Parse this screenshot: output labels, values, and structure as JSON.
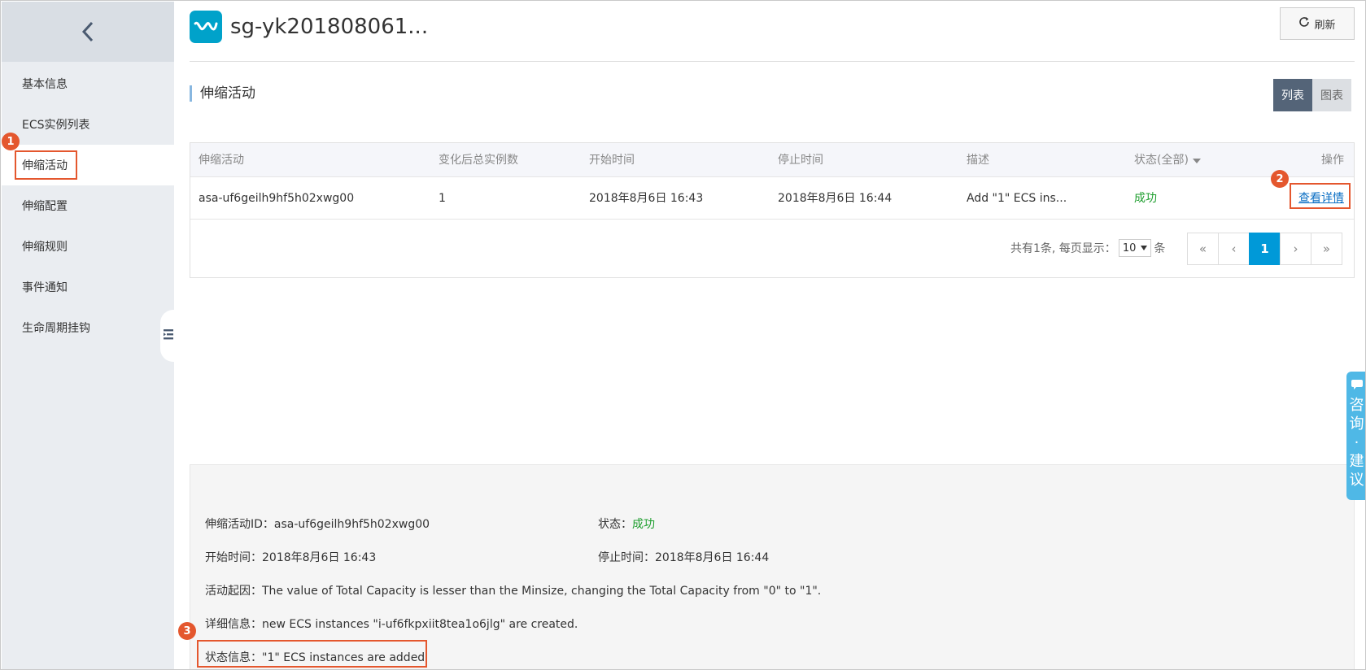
{
  "sidebar": {
    "items": [
      {
        "label": "基本信息"
      },
      {
        "label": "ECS实例列表"
      },
      {
        "label": "伸缩活动"
      },
      {
        "label": "伸缩配置"
      },
      {
        "label": "伸缩规则"
      },
      {
        "label": "事件通知"
      },
      {
        "label": "生命周期挂钩"
      }
    ],
    "active_index": 2
  },
  "header": {
    "title": "sg-yk201808061...",
    "refresh_label": "刷新"
  },
  "section": {
    "title": "伸缩活动",
    "view_list_label": "列表",
    "view_chart_label": "图表"
  },
  "table": {
    "columns": [
      "伸缩活动",
      "变化后总实例数",
      "开始时间",
      "停止时间",
      "描述",
      "状态(全部)",
      "操作"
    ],
    "rows": [
      {
        "id": "asa-uf6geilh9hf5h02xwg00",
        "total": "1",
        "start": "2018年8月6日 16:43",
        "stop": "2018年8月6日 16:44",
        "desc": "Add \"1\" ECS ins...",
        "status": "成功",
        "action": "查看详情"
      }
    ]
  },
  "pagination": {
    "summary": "共有1条, 每页显示：",
    "page_size": "10",
    "unit": "条",
    "first": "«",
    "prev": "‹",
    "current": "1",
    "next": "›",
    "last": "»"
  },
  "detail": {
    "id_label": "伸缩活动ID：",
    "id_value": "asa-uf6geilh9hf5h02xwg00",
    "status_label": "状态：",
    "status_value": "成功",
    "start_label": "开始时间：",
    "start_value": "2018年8月6日 16:43",
    "stop_label": "停止时间：",
    "stop_value": "2018年8月6日 16:44",
    "cause_label": "活动起因：",
    "cause_value": "The value of Total Capacity is lesser than the Minsize, changing the Total Capacity from \"0\" to \"1\".",
    "info_label": "详细信息：",
    "info_value": "new ECS instances \"i-uf6fkpxiit8tea1o6jlg\" are created.",
    "state_label": "状态信息：",
    "state_value": "\"1\" ECS instances are added"
  },
  "annotations": {
    "step1": "1",
    "step2": "2",
    "step3": "3"
  },
  "consult": {
    "chars": [
      "咨",
      "询",
      "·",
      "建",
      "议"
    ]
  },
  "colors": {
    "accent": "#0099d8",
    "success": "#1e9e2e",
    "highlight": "#e4572e",
    "sidebar": "#eaedf1"
  },
  "icons": [
    "back-chevron-icon",
    "app-logo-icon",
    "refresh-icon",
    "collapse-icon",
    "sort-caret-icon",
    "chat-icon"
  ]
}
